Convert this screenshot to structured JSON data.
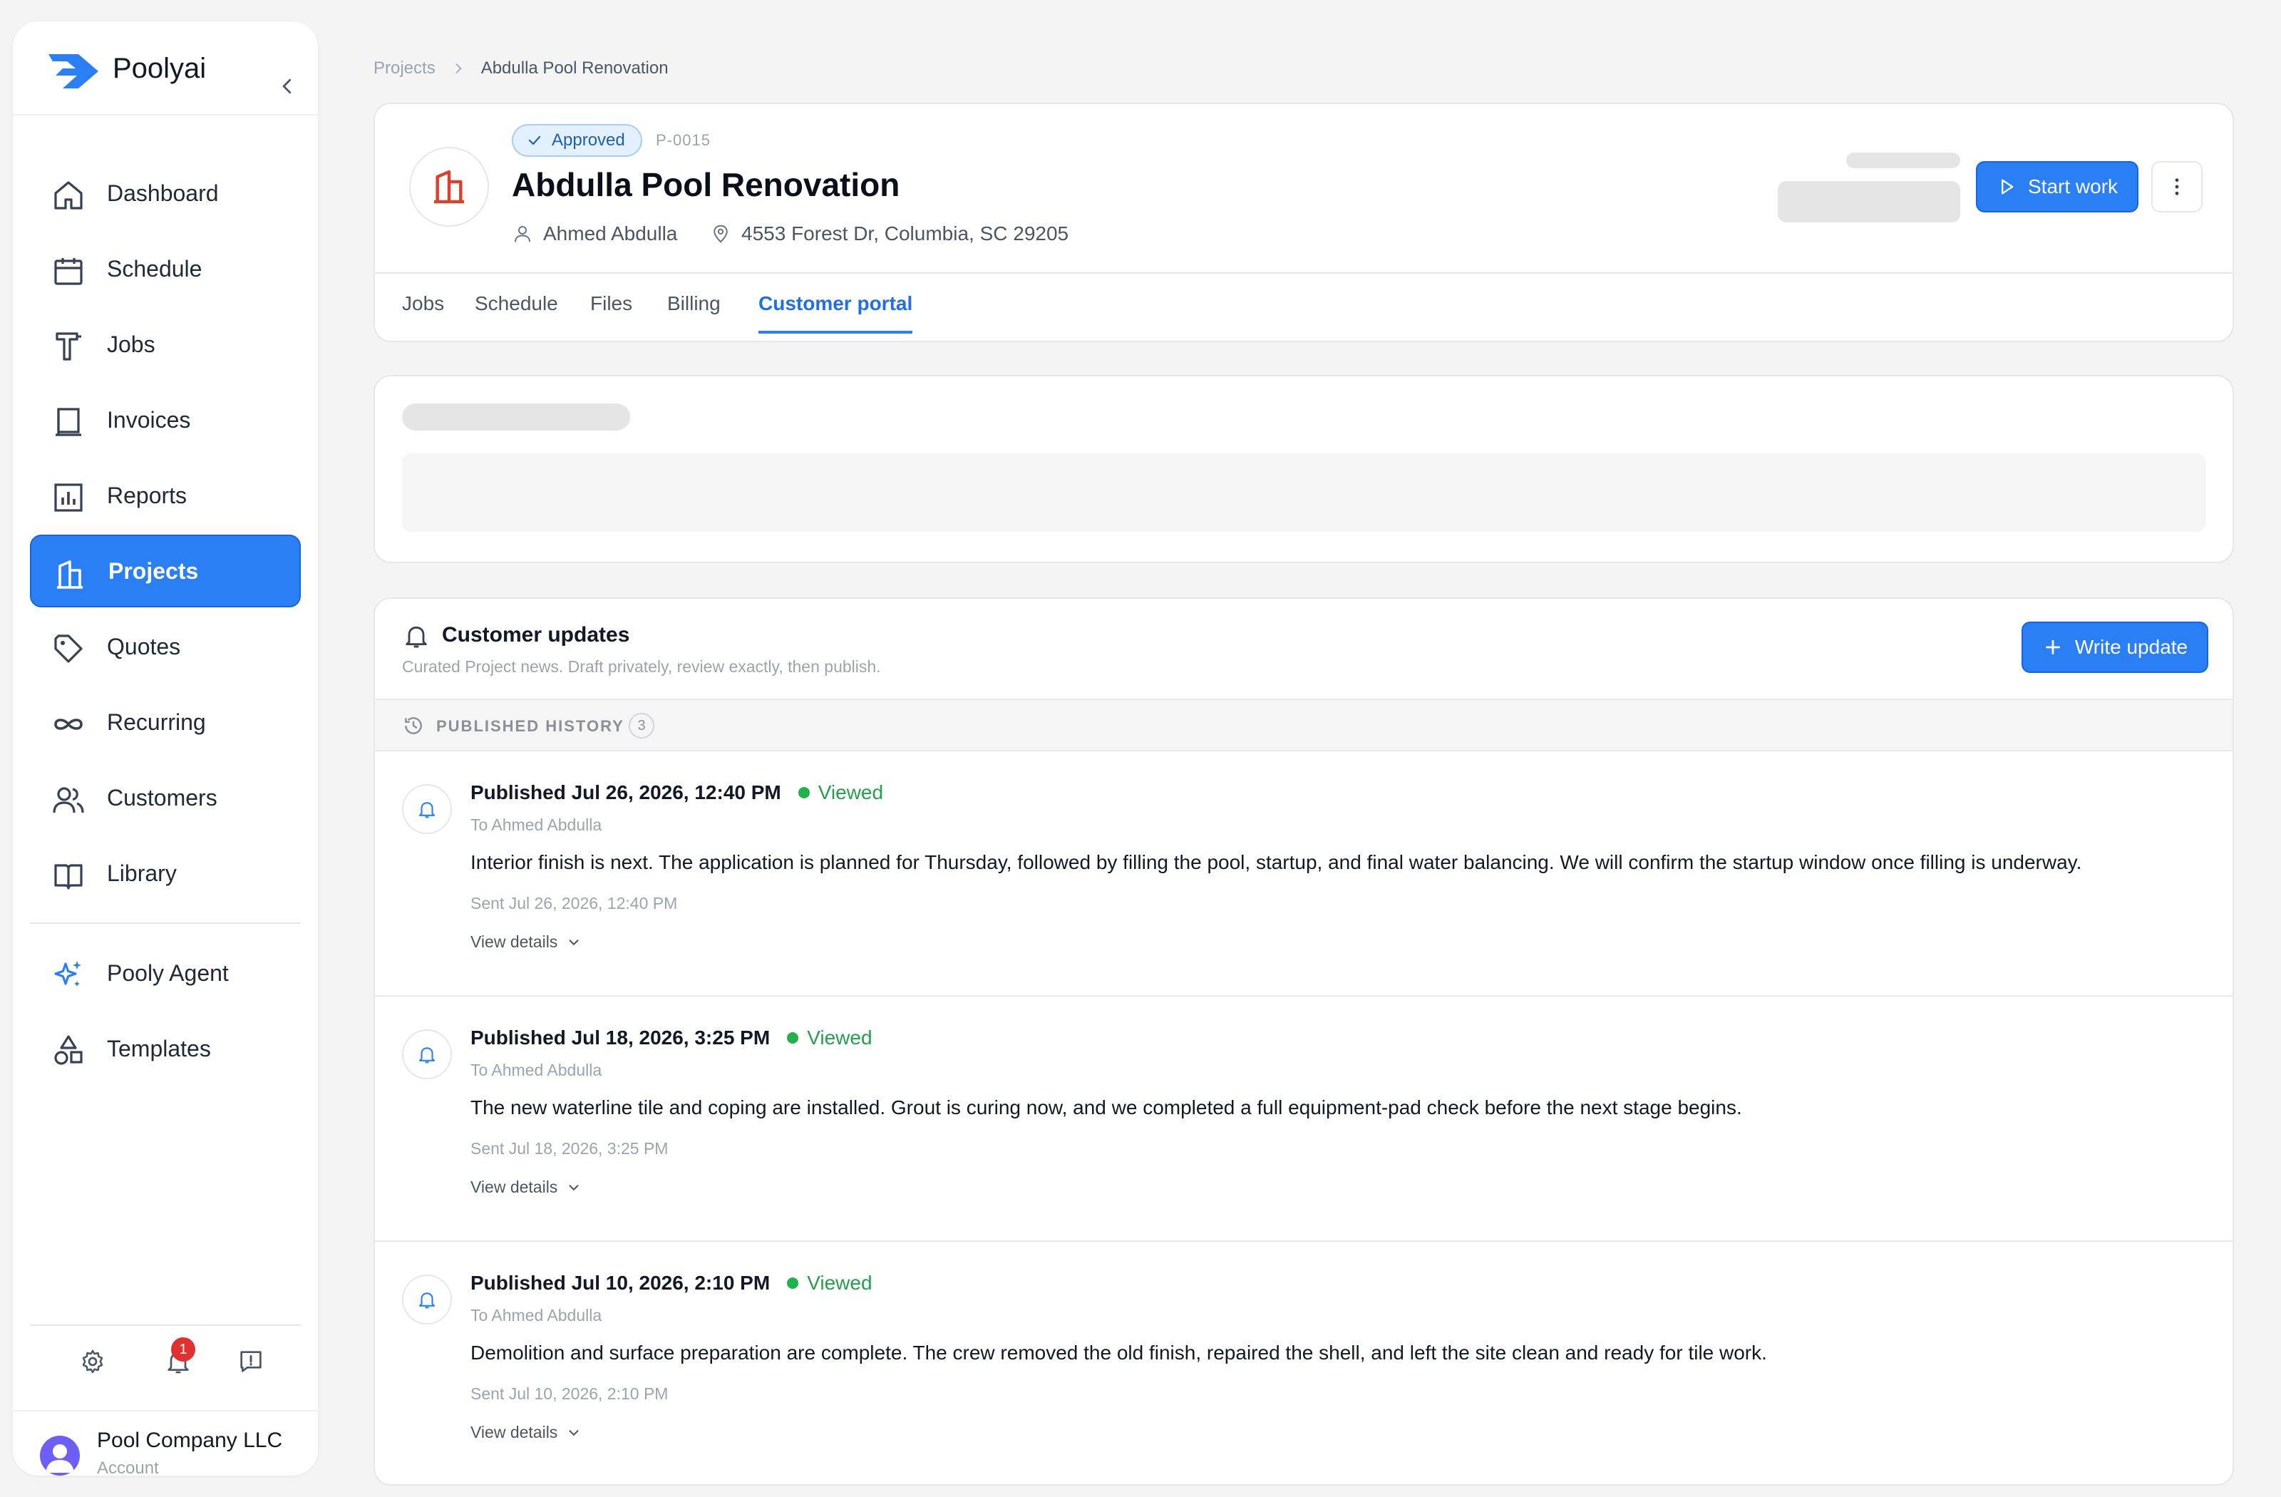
{
  "app": {
    "name": "Poolyai"
  },
  "nav": {
    "items": [
      {
        "label": "Dashboard",
        "icon": "home-icon"
      },
      {
        "label": "Schedule",
        "icon": "calendar-icon"
      },
      {
        "label": "Jobs",
        "icon": "hammer-icon"
      },
      {
        "label": "Invoices",
        "icon": "invoice-icon"
      },
      {
        "label": "Reports",
        "icon": "bar-chart-icon"
      },
      {
        "label": "Projects",
        "icon": "building-icon",
        "active": true
      },
      {
        "label": "Quotes",
        "icon": "tag-icon"
      },
      {
        "label": "Recurring",
        "icon": "infinity-icon"
      },
      {
        "label": "Customers",
        "icon": "users-icon"
      },
      {
        "label": "Library",
        "icon": "book-icon"
      }
    ],
    "secondary": [
      {
        "label": "Pooly Agent",
        "icon": "sparkles-icon"
      },
      {
        "label": "Templates",
        "icon": "shapes-icon"
      }
    ]
  },
  "footer": {
    "notification_count": "1"
  },
  "account": {
    "name": "Pool Company LLC",
    "subtitle": "Account"
  },
  "breadcrumb": {
    "parent": "Projects",
    "current": "Abdulla Pool Renovation"
  },
  "project": {
    "status": "Approved",
    "code": "P-0015",
    "title": "Abdulla Pool Renovation",
    "client": "Ahmed Abdulla",
    "address": "4553 Forest Dr, Columbia, SC 29205",
    "start_label": "Start work"
  },
  "tabs": [
    {
      "label": "Jobs"
    },
    {
      "label": "Schedule"
    },
    {
      "label": "Files"
    },
    {
      "label": "Billing"
    },
    {
      "label": "Customer portal",
      "active": true
    }
  ],
  "updates": {
    "title": "Customer updates",
    "subtitle": "Curated Project news. Draft privately, review exactly, then publish.",
    "write_label": "Write update",
    "history_label": "PUBLISHED HISTORY",
    "history_count": "3",
    "items": [
      {
        "published": "Published Jul 26, 2026, 12:40 PM",
        "status": "Viewed",
        "to": "To Ahmed Abdulla",
        "body": "Interior finish is next. The application is planned for Thursday, followed by filling the pool, startup, and final water balancing. We will confirm the startup window once filling is underway.",
        "sent": "Sent Jul 26, 2026, 12:40 PM",
        "details_label": "View details"
      },
      {
        "published": "Published Jul 18, 2026, 3:25 PM",
        "status": "Viewed",
        "to": "To Ahmed Abdulla",
        "body": "The new waterline tile and coping are installed. Grout is curing now, and we completed a full equipment-pad check before the next stage begins.",
        "sent": "Sent Jul 18, 2026, 3:25 PM",
        "details_label": "View details"
      },
      {
        "published": "Published Jul 10, 2026, 2:10 PM",
        "status": "Viewed",
        "to": "To Ahmed Abdulla",
        "body": "Demolition and surface preparation are complete. The crew removed the old finish, repaired the shell, and left the site clean and ready for tile work.",
        "sent": "Sent Jul 10, 2026, 2:10 PM",
        "details_label": "View details"
      }
    ]
  },
  "colors": {
    "accent": "#2a7ff5",
    "viewed": "#22b14c",
    "project_icon": "#d9412b",
    "badge": "#e03131"
  }
}
